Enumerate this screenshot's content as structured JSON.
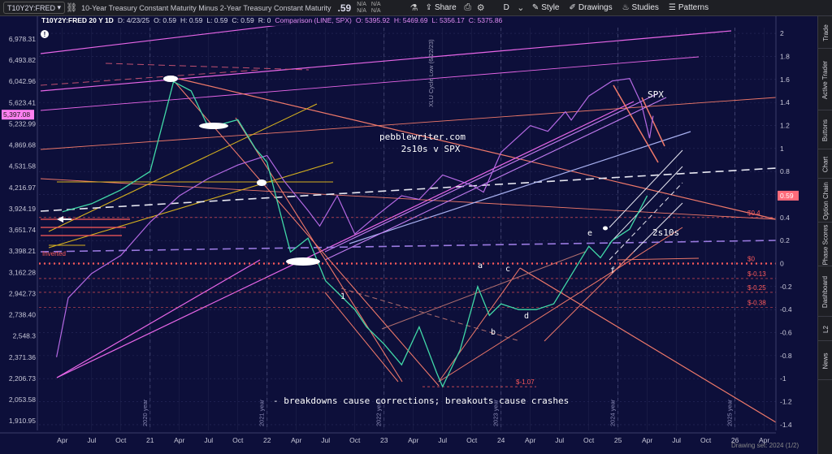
{
  "toolbar": {
    "symbol": "T10Y2Y:FRED",
    "title": "10-Year Treasury Constant Maturity Minus 2-Year Treasury Constant Maturity",
    "last": ".59",
    "na1": "N/A",
    "na2": "N/A",
    "na3": "N/A",
    "na4": "N/A",
    "share": "Share",
    "interval": "D",
    "style": "Style",
    "drawings": "Drawings",
    "studies": "Studies",
    "patterns": "Patterns"
  },
  "info_bar": {
    "symbol": "T10Y2Y:FRED 20 Y 1D",
    "date": "D: 4/23/25",
    "open": "O: 0.59",
    "high": "H: 0.59",
    "low": "L: 0.59",
    "close": "C: 0.59",
    "range": "R: 0",
    "comparison": "Comparison (LINE, SPX)",
    "cmp_open": "O: 5395.92",
    "cmp_high": "H: 5469.69",
    "cmp_low": "L: 5356.17",
    "cmp_close": "C: 5375.86"
  },
  "side_tabs": [
    "Trade",
    "Active Trader",
    "Buttons",
    "Chart",
    "Option Chain",
    "Phase Scores",
    "Dashboard",
    "L2",
    "News"
  ],
  "chart_data": {
    "type": "line",
    "left_axis": {
      "label": "SPX",
      "ticks": [
        "6,978.31",
        "6,493.82",
        "6,042.96",
        "5,623.41",
        "5,232.99",
        "4,869.68",
        "4,531.58",
        "4,216.97",
        "3,924.19",
        "3,651.74",
        "3,398.21",
        "3,162.28",
        "2,942.73",
        "2,738.40",
        "2,548.3",
        "2,371.36",
        "2,206.73",
        "2,053.58",
        "1,910.95"
      ],
      "current_label": "5,397.08"
    },
    "right_axis": {
      "label": "T10Y2Y",
      "ticks": [
        "2",
        "1.8",
        "1.6",
        "1.4",
        "1.2",
        "1",
        "0.8",
        "0.6",
        "0.4",
        "0.2",
        "0",
        "-0.2",
        "-0.4",
        "-0.6",
        "-0.8",
        "-1",
        "-1.2",
        "-1.4"
      ],
      "current_label": "0.59",
      "ylim": [
        -1.45,
        2.05
      ]
    },
    "x_axis": {
      "ticks": [
        "Apr",
        "Jul",
        "Oct",
        "21",
        "Apr",
        "Jul",
        "Oct",
        "22",
        "Apr",
        "Jul",
        "Oct",
        "23",
        "Apr",
        "Jul",
        "Oct",
        "24",
        "Apr",
        "Jul",
        "Oct",
        "25",
        "Apr",
        "Jul",
        "Oct",
        "26",
        "Apr"
      ],
      "year_labels": [
        "2020 year",
        "2021 year",
        "2022 year",
        "2023 year",
        "2024 year",
        "2025 year"
      ]
    },
    "series": [
      {
        "name": "T10Y2Y",
        "color": "#41d9a8",
        "points": [
          [
            2020.25,
            0.45
          ],
          [
            2020.5,
            0.52
          ],
          [
            2020.75,
            0.64
          ],
          [
            2021.0,
            0.8
          ],
          [
            2021.2,
            1.58
          ],
          [
            2021.35,
            1.5
          ],
          [
            2021.5,
            1.18
          ],
          [
            2021.75,
            1.25
          ],
          [
            2021.9,
            1.0
          ],
          [
            2022.0,
            0.88
          ],
          [
            2022.2,
            0.1
          ],
          [
            2022.35,
            0.22
          ],
          [
            2022.5,
            -0.15
          ],
          [
            2022.6,
            -0.25
          ],
          [
            2022.75,
            -0.4
          ],
          [
            2022.85,
            -0.55
          ],
          [
            2023.0,
            -0.7
          ],
          [
            2023.15,
            -0.88
          ],
          [
            2023.3,
            -0.55
          ],
          [
            2023.45,
            -0.95
          ],
          [
            2023.5,
            -1.07
          ],
          [
            2023.65,
            -0.75
          ],
          [
            2023.8,
            -0.2
          ],
          [
            2023.9,
            -0.45
          ],
          [
            2024.0,
            -0.35
          ],
          [
            2024.15,
            -0.4
          ],
          [
            2024.3,
            -0.4
          ],
          [
            2024.45,
            -0.35
          ],
          [
            2024.6,
            -0.1
          ],
          [
            2024.75,
            0.15
          ],
          [
            2024.85,
            0.05
          ],
          [
            2024.95,
            0.2
          ],
          [
            2025.1,
            0.3
          ],
          [
            2025.25,
            0.59
          ]
        ]
      },
      {
        "name": "SPX",
        "color": "#b469e3",
        "points": [
          [
            2020.2,
            2371.36
          ],
          [
            2020.3,
            2900
          ],
          [
            2020.5,
            3150
          ],
          [
            2020.75,
            3350
          ],
          [
            2021.0,
            3750
          ],
          [
            2021.25,
            4100
          ],
          [
            2021.5,
            4350
          ],
          [
            2021.75,
            4550
          ],
          [
            2022.0,
            4700
          ],
          [
            2022.15,
            4300
          ],
          [
            2022.35,
            3900
          ],
          [
            2022.45,
            3700
          ],
          [
            2022.6,
            4100
          ],
          [
            2022.75,
            3600
          ],
          [
            2022.95,
            3850
          ],
          [
            2023.15,
            4100
          ],
          [
            2023.3,
            4050
          ],
          [
            2023.5,
            4400
          ],
          [
            2023.75,
            4250
          ],
          [
            2023.85,
            4150
          ],
          [
            2024.0,
            4750
          ],
          [
            2024.25,
            5200
          ],
          [
            2024.4,
            5100
          ],
          [
            2024.55,
            5450
          ],
          [
            2024.6,
            5300
          ],
          [
            2024.75,
            5750
          ],
          [
            2024.95,
            6050
          ],
          [
            2025.1,
            6100
          ],
          [
            2025.2,
            5600
          ],
          [
            2025.27,
            4982
          ],
          [
            2025.3,
            5375.86
          ]
        ]
      }
    ],
    "levels": [
      {
        "label": "$0.4",
        "value": 0.4,
        "color": "#ff5a5a"
      },
      {
        "label": "$0",
        "value": 0,
        "color": "#ff5a5a"
      },
      {
        "label": "$-0.13",
        "value": -0.13,
        "color": "#ff5a5a"
      },
      {
        "label": "$-0.25",
        "value": -0.25,
        "color": "#ff5a5a"
      },
      {
        "label": "$-0.38",
        "value": -0.38,
        "color": "#ff5a5a"
      },
      {
        "label": "$-1.07",
        "value": -1.07,
        "color": "#ff5a5a"
      }
    ],
    "annotations": {
      "site": "pebblewriter.com",
      "subtitle": "2s10s v SPX",
      "spx_label": "SPX",
      "curve_label": "2s10s",
      "inverted_label": "Inverted",
      "cycle_low": "XLU Cycle Low (6/22/23)",
      "wave_a": "a",
      "wave_b": "b",
      "wave_c": "c",
      "wave_d": "d",
      "wave_e": "e",
      "wave_f": "f",
      "wave_1": "1",
      "caption": "- breakdowns cause corrections; breakouts cause crashes"
    },
    "grid": true
  },
  "colors": {
    "background": "#0d0f3a",
    "curve": "#41d9a8",
    "spx": "#b469e3",
    "level": "#ff5a5a",
    "trend_magenta": "#e866e8",
    "trend_salmon": "#f0796a",
    "trend_gold": "#d7b21e",
    "trend_white": "#e8e8f2"
  },
  "bottom": {
    "drawing_label": "Drawing set: 2024 (1/2)"
  }
}
